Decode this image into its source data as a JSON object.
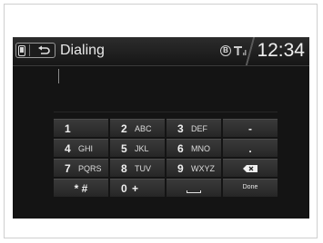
{
  "header": {
    "title": "Dialing",
    "clock": "12:34",
    "icons": [
      "phone-icon",
      "back-icon",
      "bluetooth-icon",
      "signal-icon"
    ],
    "bluetooth_glyph": "B"
  },
  "keypad": {
    "keys": [
      {
        "digit": "1",
        "letters": ""
      },
      {
        "digit": "2",
        "letters": "ABC"
      },
      {
        "digit": "3",
        "letters": "DEF"
      },
      {
        "symbol": "-"
      },
      {
        "digit": "4",
        "letters": "GHI"
      },
      {
        "digit": "5",
        "letters": "JKL"
      },
      {
        "digit": "6",
        "letters": "MNO"
      },
      {
        "symbol": "."
      },
      {
        "digit": "7",
        "letters": "PQRS"
      },
      {
        "digit": "8",
        "letters": "TUV"
      },
      {
        "digit": "9",
        "letters": "WXYZ"
      },
      {
        "icon": "backspace-icon"
      },
      {
        "symbol": "* #"
      },
      {
        "digit": "0",
        "letters": "+"
      },
      {
        "icon": "space-icon"
      },
      {
        "label": "Done"
      }
    ]
  },
  "colors": {
    "screen_bg": "#141414",
    "key_bg": "#2e2e2e",
    "text": "#f0f0f0"
  }
}
